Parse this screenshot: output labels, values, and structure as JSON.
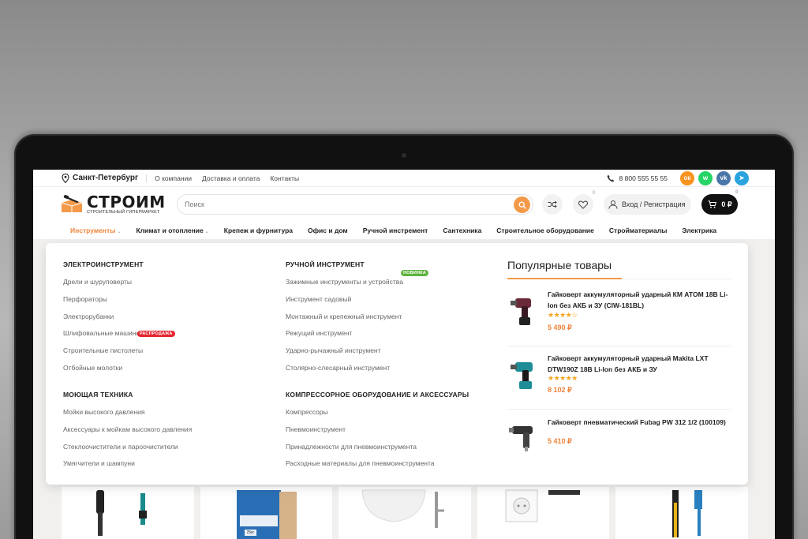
{
  "topbar": {
    "city": "Санкт-Петербург",
    "links": [
      "О компании",
      "Доставка и оплата",
      "Контакты"
    ],
    "phone": "8 800 555 55 55",
    "socials": [
      {
        "name": "odnoklassniki",
        "color": "#f7931e",
        "glyph": "ок"
      },
      {
        "name": "whatsapp",
        "color": "#25d366",
        "glyph": "w"
      },
      {
        "name": "vk",
        "color": "#4a76a8",
        "glyph": "vk"
      },
      {
        "name": "telegram",
        "color": "#2aa3df",
        "glyph": "➤"
      }
    ]
  },
  "header": {
    "logo_main": "СТРОИМ",
    "logo_sub": "СТРОИТЕЛЬНЫЙ ГИПЕРМАРКЕТ",
    "search_placeholder": "Поиск",
    "compare_count": "",
    "favorites_count": "0",
    "login_label": "Вход / Регистрация",
    "cart_total": "0 ₽",
    "cart_count": "0"
  },
  "nav": [
    {
      "label": "Инструменты",
      "active": true,
      "caret": true
    },
    {
      "label": "Климат и отопление",
      "active": false,
      "caret": true
    },
    {
      "label": "Крепеж и фурнитура",
      "active": false,
      "caret": false
    },
    {
      "label": "Офис и дом",
      "active": false,
      "caret": false
    },
    {
      "label": "Ручной инстремент",
      "active": false,
      "caret": false
    },
    {
      "label": "Сантехника",
      "active": false,
      "caret": false
    },
    {
      "label": "Строительное оборудование",
      "active": false,
      "caret": false
    },
    {
      "label": "Стройматериалы",
      "active": false,
      "caret": false
    },
    {
      "label": "Электрика",
      "active": false,
      "caret": false
    }
  ],
  "menu": {
    "col1": [
      {
        "title": "ЭЛЕКТРОИНСТРУМЕНТ",
        "links": [
          "Дрели и шуруповерты",
          "Перфораторы",
          "Электрорубанки",
          "Шлифовальные машины",
          "Строительные пистолеты",
          "Отбойные молотки"
        ],
        "badge": {
          "text": "РАСПРОДАЖА",
          "color": "#e5262f",
          "after_link": 3
        }
      },
      {
        "title": "МОЮЩАЯ ТЕХНИКА",
        "links": [
          "Мойки высокого давления",
          "Аксессуары к мойкам высокого давления",
          "Стеклоочистители и пароочистители",
          "Умягчители и шампуни"
        ]
      }
    ],
    "col2": [
      {
        "title": "РУЧНОЙ ИНСТРУМЕНТ",
        "links": [
          "Зажимные инструменты и устройства",
          "Инструмент садовый",
          "Монтажный и крепежный инструмент",
          "Режущий инструмент",
          "Ударно-рычажный инструмент",
          "Столярно-слесарный инструмент"
        ],
        "badge": {
          "text": "НОВИНКА",
          "color": "#5fb33f",
          "after_link": 0
        }
      },
      {
        "title": "КОМПРЕССОРНОЕ ОБОРУДОВАНИЕ И АКСЕССУАРЫ",
        "links": [
          "Компрессоры",
          "Пневмоинструмент",
          "Принадлежности для пневмоинструмента",
          "Расходные материалы для пневмоинструмента"
        ]
      }
    ]
  },
  "popular": {
    "title": "Популярные товары",
    "products": [
      {
        "name": "Гайковерт аккумуляторный ударный КМ АТОМ 18В Li-Ion без АКБ и ЗУ (CIW-181BL)",
        "rating": "★★★★☆",
        "price": "5 490 ₽",
        "icon": "drill-maroon-icon"
      },
      {
        "name": "Гайковерт аккумуляторный ударный Makita LXT DTW190Z 18В Li-Ion без АКБ и ЗУ",
        "rating": "★★★★★",
        "price": "8 102 ₽",
        "icon": "drill-teal-icon"
      },
      {
        "name": "Гайковерт пневматический Fubag PW 312 1/2 (100109)",
        "rating": "",
        "price": "5 410 ₽",
        "icon": "pneumatic-wrench-icon"
      }
    ]
  },
  "strip": {
    "bag_label": "25кг"
  }
}
